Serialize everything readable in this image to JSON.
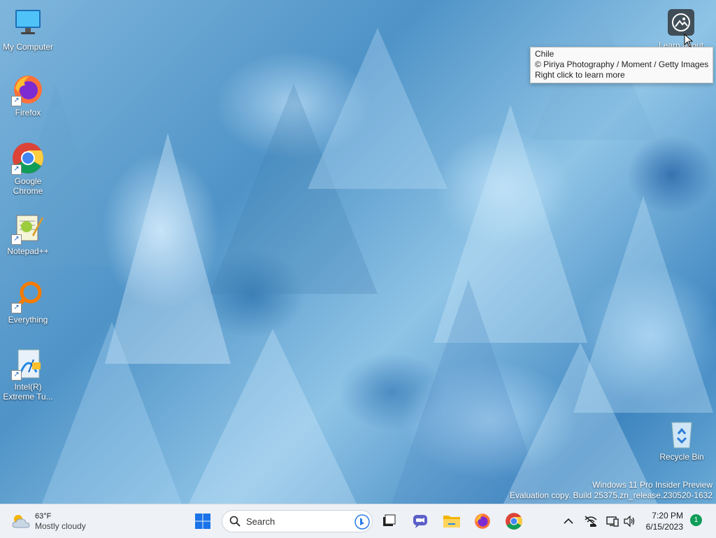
{
  "desktop": {
    "icons": [
      {
        "label": "My Computer"
      },
      {
        "label": "Firefox"
      },
      {
        "label": "Google Chrome"
      },
      {
        "label": "Notepad++"
      },
      {
        "label": "Everything"
      },
      {
        "label": "Intel(R) Extreme Tu..."
      },
      {
        "label": "Recycle Bin"
      }
    ],
    "learn_about_label": "Learn about",
    "tooltip": {
      "title": "Chile",
      "credit": "© Piriya Photography / Moment / Getty Images",
      "hint": "Right click to learn more"
    },
    "watermark": {
      "line1": "Windows 11 Pro Insider Preview",
      "line2": "Evaluation copy. Build 25375.zn_release.230520-1632"
    }
  },
  "taskbar": {
    "weather": {
      "temp": "63°F",
      "condition": "Mostly cloudy"
    },
    "search_label": "Search",
    "pinned": [
      {
        "icon": "windows-start-icon"
      },
      {
        "icon": "task-view-icon"
      },
      {
        "icon": "chat-icon"
      },
      {
        "icon": "file-explorer-icon"
      },
      {
        "icon": "firefox-icon"
      },
      {
        "icon": "chrome-icon"
      }
    ],
    "tray": {
      "time": "7:20 PM",
      "date": "6/15/2023",
      "notifications": "1"
    }
  },
  "colors": {
    "taskbar_bg": "#eef1f6",
    "windows_blue": "#1a73e8",
    "badge_green": "#0f9d58"
  }
}
